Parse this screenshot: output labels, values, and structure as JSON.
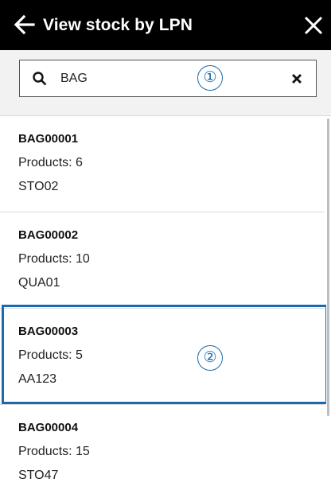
{
  "header": {
    "title": "View stock by LPN",
    "back_icon": "arrow-left-icon",
    "close_icon": "close-icon",
    "background": "#000000"
  },
  "search": {
    "value": "BAG",
    "search_icon": "search-icon",
    "clear_icon": "clear-icon"
  },
  "callouts": {
    "marker_1": "①",
    "marker_2": "②",
    "color": "#1a6ab0"
  },
  "items": [
    {
      "lpn": "BAG00001",
      "products": "Products: 6",
      "location": "STO02"
    },
    {
      "lpn": "BAG00002",
      "products": "Products: 10",
      "location": "QUA01"
    },
    {
      "lpn": "BAG00003",
      "products": "Products: 5",
      "location": "AA123"
    },
    {
      "lpn": "BAG00004",
      "products": "Products: 15",
      "location": "STO47"
    }
  ]
}
